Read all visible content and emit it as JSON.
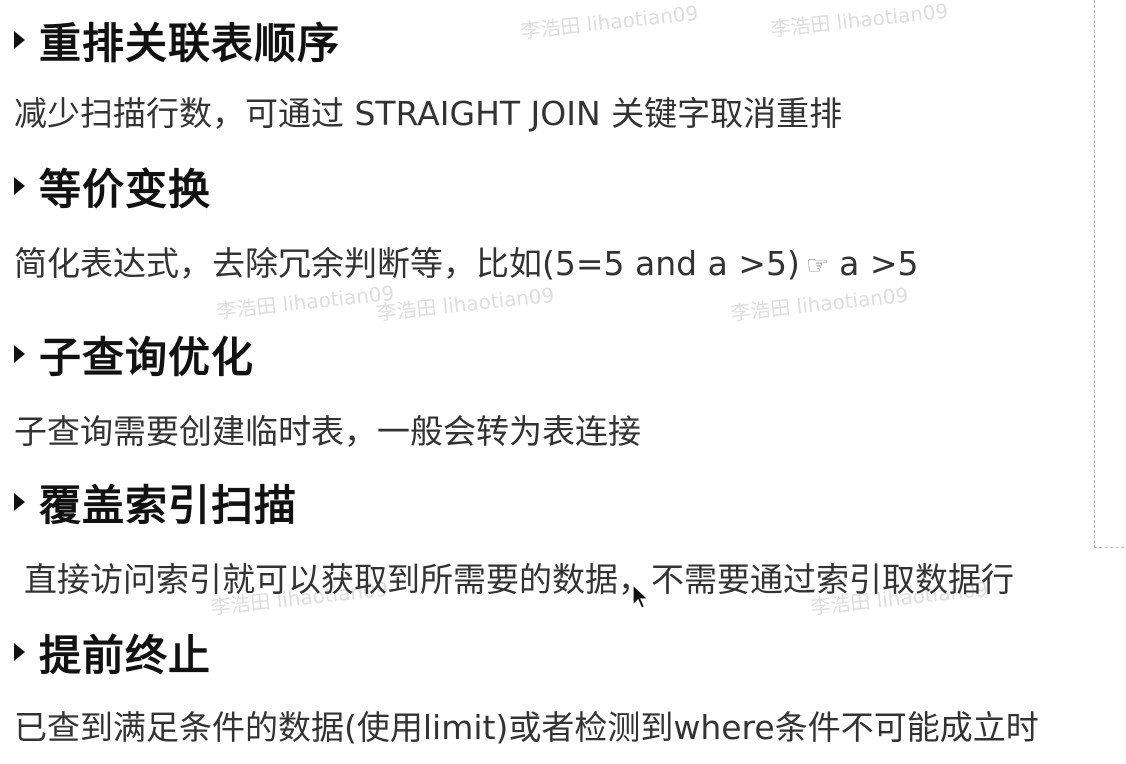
{
  "sections": [
    {
      "heading": "重排关联表顺序",
      "desc": "减少扫描行数，可通过 STRAIGHT JOIN 关键字取消重排"
    },
    {
      "heading": "等价变换",
      "desc_before": "简化表达式，去除冗余判断等，比如(5=5 and a >5)",
      "desc_after": "a >5"
    },
    {
      "heading": "子查询优化",
      "desc": "子查询需要创建临时表，一般会转为表连接"
    },
    {
      "heading": "覆盖索引扫描",
      "desc": "直接访问索引就可以获取到所需要的数据，不需要通过索引取数据行"
    },
    {
      "heading": "提前终止",
      "desc": "已查到满足条件的数据(使用limit)或者检测到where条件不可能成立时"
    }
  ],
  "watermark": "李浩田 lihaotian09",
  "icons": {
    "bullet": "triangle-right-icon",
    "arrow": "pointing-hand-icon",
    "cursor": "mouse-cursor-icon"
  }
}
